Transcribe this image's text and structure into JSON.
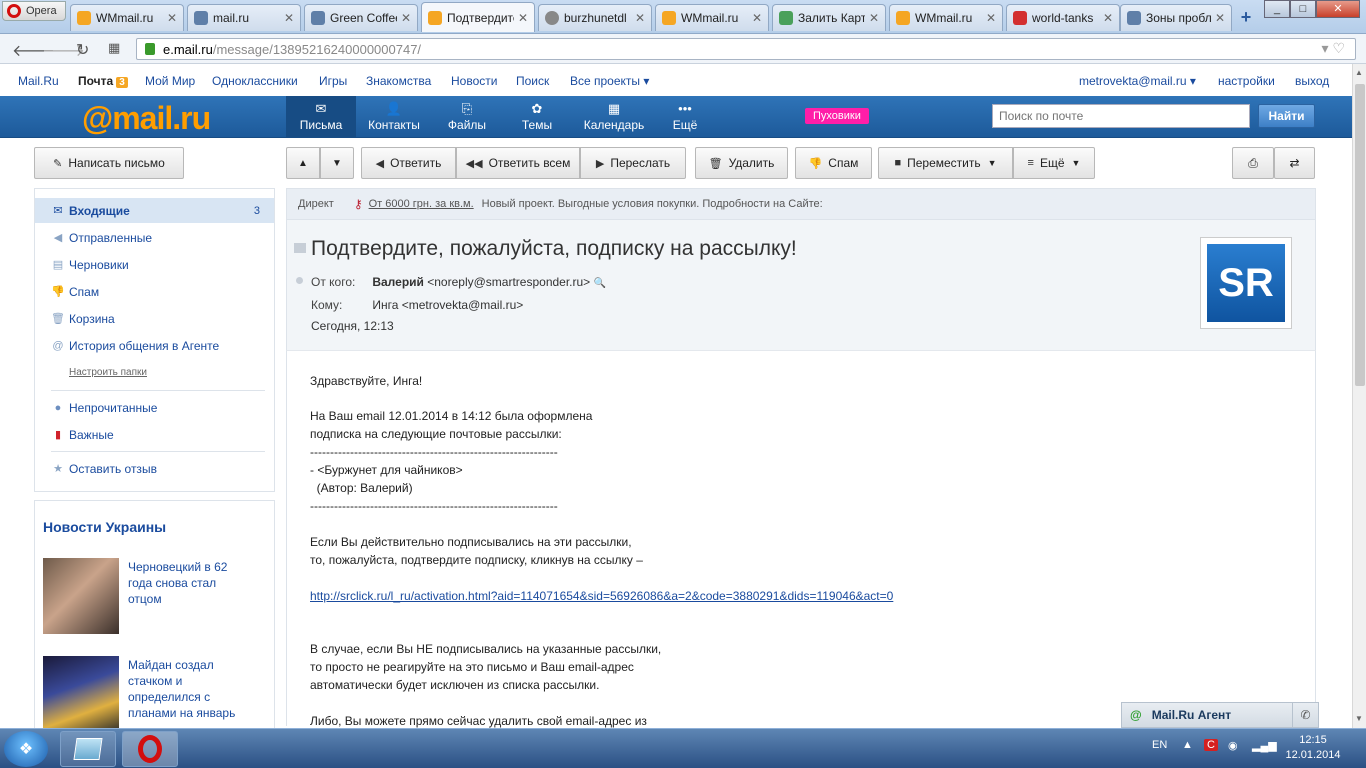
{
  "browser": {
    "opera_label": "Opera",
    "tabs": [
      {
        "label": "WMmail.ru",
        "color": "#f5a623"
      },
      {
        "label": "mail.ru",
        "color": "#5f7fa8"
      },
      {
        "label": "Green Coffee",
        "color": "#5f7fa8"
      },
      {
        "label": "Подтвердите",
        "color": "#f5a623"
      },
      {
        "label": "burzhunetdl",
        "color": "#888888"
      },
      {
        "label": "WMmail.ru",
        "color": "#f5a623"
      },
      {
        "label": "Залить Карт",
        "color": "#4aa05a"
      },
      {
        "label": "WMmail.ru",
        "color": "#f5a623"
      },
      {
        "label": "world-tanks",
        "color": "#d32f2f"
      },
      {
        "label": "Зоны пробле",
        "color": "#5f7fa8"
      }
    ],
    "url_host": "e.mail.ru",
    "url_path": "/message/13895216240000000747/"
  },
  "portal": {
    "links": [
      "Mail.Ru",
      "Почта",
      "Мой Мир",
      "Одноклассники",
      "Игры",
      "Знакомства",
      "Новости",
      "Поиск",
      "Все проекты"
    ],
    "mail_count": "3",
    "user": "metrovekta@mail.ru",
    "settings": "настройки",
    "logout": "выход"
  },
  "header": {
    "logo": "@mail.ru",
    "nav": [
      {
        "label": "Письма",
        "icon": "envelope-icon"
      },
      {
        "label": "Контакты",
        "icon": "contacts-icon"
      },
      {
        "label": "Файлы",
        "icon": "paperclip-icon"
      },
      {
        "label": "Темы",
        "icon": "palette-icon"
      },
      {
        "label": "Календарь",
        "icon": "calendar-icon"
      },
      {
        "label": "Ещё",
        "icon": "dots-icon"
      }
    ],
    "promo": "Пуховики",
    "search_placeholder": "Поиск по почте",
    "search_button": "Найти"
  },
  "toolbar": {
    "compose": "Написать письмо",
    "reply": "Ответить",
    "reply_all": "Ответить всем",
    "forward": "Переслать",
    "delete": "Удалить",
    "spam": "Спам",
    "move": "Переместить",
    "more": "Ещё"
  },
  "folders": {
    "items": [
      {
        "label": "Входящие",
        "count": "3"
      },
      {
        "label": "Отправленные",
        "count": ""
      },
      {
        "label": "Черновики",
        "count": ""
      },
      {
        "label": "Спам",
        "count": ""
      },
      {
        "label": "Корзина",
        "count": ""
      },
      {
        "label": "История общения в Агенте",
        "count": ""
      }
    ],
    "configure": "Настроить папки",
    "unread": "Непрочитанные",
    "important": "Важные",
    "feedback": "Оставить отзыв"
  },
  "news": {
    "title": "Новости Украины",
    "items": [
      {
        "text": "Черновецкий в 62 года снова стал отцом"
      },
      {
        "text": "Майдан создал стачком и определился с планами на январь"
      }
    ]
  },
  "direct": {
    "label": "Директ",
    "ad_link": "От 6000 грн. за кв.м.",
    "ad_text": "Новый проект. Выгодные условия покупки. Подробности на Сайте:"
  },
  "message": {
    "subject": "Подтвердите, пожалуйста, подписку на рассылку!",
    "from_label": "От кого:",
    "from_name": "Валерий",
    "from_email": "<noreply@smartresponder.ru>",
    "to_label": "Кому:",
    "to_value": "Инга <metrovekta@mail.ru>",
    "date": "Сегодня, 12:13",
    "avatar_text": "SR",
    "body": {
      "l1": "Здравствуйте, Инга!",
      "l2": "На Ваш email 12.01.2014 в 14:12 была оформлена",
      "l3": "подписка на следующие почтовые рассылки:",
      "l4": "--------------------------------------------------------------",
      "l5": "- <Буржунет для чайников>",
      "l6": "  (Автор: Валерий)",
      "l7": "--------------------------------------------------------------",
      "l8": "Если Вы действительно подписывались на эти рассылки,",
      "l9": "то, пожалуйста, подтвердите подписку, кликнув на ссылку –",
      "link": "http://srclick.ru/l_ru/activation.html?aid=114071654&sid=56926086&a=2&code=3880291&dids=119046&act=0",
      "l10": "В случае, если Вы НЕ подписывались на указанные рассылки,",
      "l11": "то просто не реагируйте на это письмо и Ваш email-адрес",
      "l12": "автоматически будет исключен из списка рассылки.",
      "l13": "Либо, Вы можете прямо сейчас удалить свой email-адрес из"
    }
  },
  "agent": {
    "label": "Mail.Ru Агент"
  },
  "taskbar": {
    "lang": "EN",
    "time": "12:15",
    "date": "12.01.2014"
  }
}
